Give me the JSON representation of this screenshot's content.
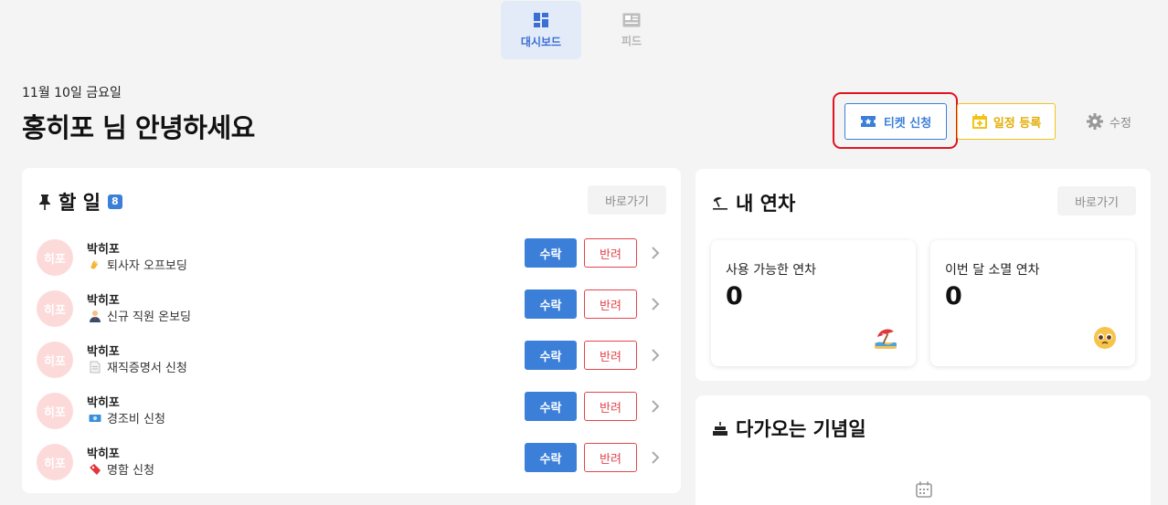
{
  "nav": {
    "tabs": [
      {
        "label": "대시보드",
        "icon": "dashboard-icon",
        "active": true
      },
      {
        "label": "피드",
        "icon": "feed-icon",
        "active": false
      }
    ]
  },
  "header": {
    "date": "11월 10일 금요일",
    "greeting": "홍히포 님 안녕하세요",
    "ticket_label": "티켓 신청",
    "schedule_label": "일정 등록",
    "edit_label": "수정"
  },
  "todo": {
    "title": "할 일",
    "count": "8",
    "goto_label": "바로가기",
    "accept_label": "수락",
    "reject_label": "반려",
    "items": [
      {
        "avatar": "히포",
        "name": "박히포",
        "emoji": "waving-hand-icon",
        "desc": "퇴사자 오프보딩"
      },
      {
        "avatar": "히포",
        "name": "박히포",
        "emoji": "person-suit-icon",
        "desc": "신규 직원 온보딩"
      },
      {
        "avatar": "히포",
        "name": "박히포",
        "emoji": "document-icon",
        "desc": "재직증명서 신청"
      },
      {
        "avatar": "히포",
        "name": "박히포",
        "emoji": "money-icon",
        "desc": "경조비 신청"
      },
      {
        "avatar": "히포",
        "name": "박히포",
        "emoji": "ticket-icon",
        "desc": "명함 신청"
      }
    ]
  },
  "leave": {
    "title": "내 연차",
    "goto_label": "바로가기",
    "available_label": "사용 가능한 연차",
    "available_value": "0",
    "expiring_label": "이번 달 소멸 연차",
    "expiring_value": "0"
  },
  "anniversary": {
    "title": "다가오는 기념일"
  },
  "colors": {
    "primary": "#3b7fd9",
    "danger": "#e2454b",
    "warning": "#f2c318",
    "highlight": "#e0141f",
    "avatar_bg": "#fddada"
  }
}
